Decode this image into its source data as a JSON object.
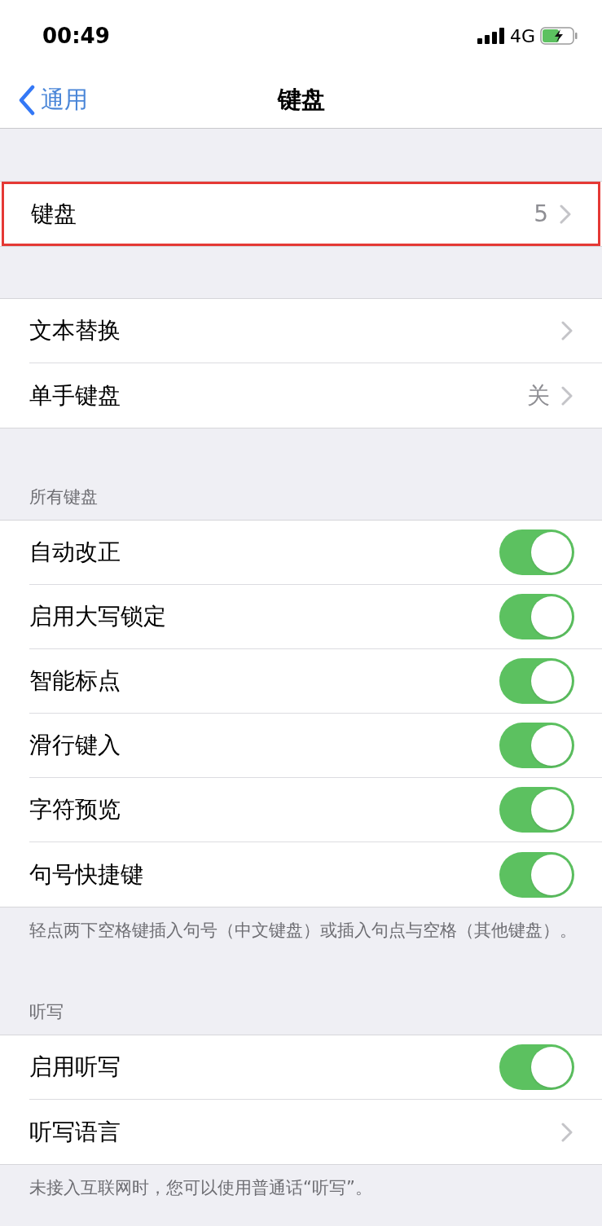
{
  "status_bar": {
    "time": "00:49",
    "network": "4G"
  },
  "nav": {
    "back": "通用",
    "title": "键盘"
  },
  "sections": [
    {
      "rows": [
        {
          "kind": "link",
          "label": "键盘",
          "value": "5",
          "highlighted": true
        }
      ]
    },
    {
      "rows": [
        {
          "kind": "link",
          "label": "文本替换",
          "highlighted": false
        },
        {
          "kind": "link",
          "label": "单手键盘",
          "value": "关",
          "highlighted": false
        }
      ]
    },
    {
      "header": "所有键盘",
      "footer": "轻点两下空格键插入句号（中文键盘）或插入句点与空格（其他键盘）。",
      "rows": [
        {
          "kind": "toggle",
          "label": "自动改正",
          "on": true
        },
        {
          "kind": "toggle",
          "label": "启用大写锁定",
          "on": true
        },
        {
          "kind": "toggle",
          "label": "智能标点",
          "on": true
        },
        {
          "kind": "toggle",
          "label": "滑行键入",
          "on": true
        },
        {
          "kind": "toggle",
          "label": "字符预览",
          "on": true
        },
        {
          "kind": "toggle",
          "label": "句号快捷键",
          "on": true
        }
      ]
    },
    {
      "header": "听写",
      "footer": "未接入互联网时，您可以使用普通话“听写”。",
      "rows": [
        {
          "kind": "toggle",
          "label": "启用听写",
          "on": true
        },
        {
          "kind": "link",
          "label": "听写语言",
          "highlighted": false
        }
      ]
    }
  ]
}
